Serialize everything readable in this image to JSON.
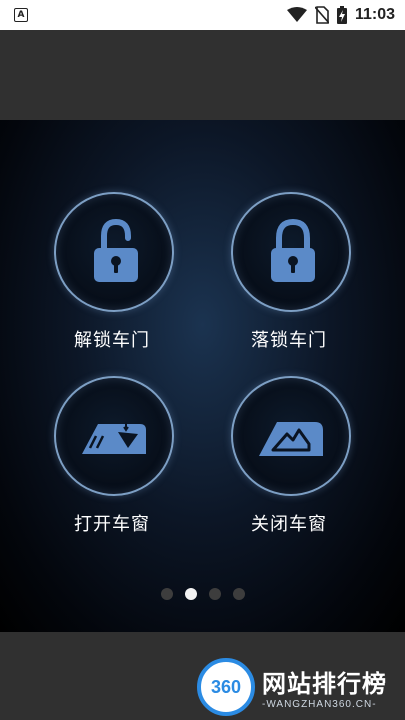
{
  "status_bar": {
    "time": "11:03",
    "app_indicator": "A",
    "icons": [
      "wifi-icon",
      "no-sim-icon",
      "battery-charging-icon"
    ]
  },
  "controls": [
    {
      "label": "解锁车门",
      "icon": "unlock-icon"
    },
    {
      "label": "落锁车门",
      "icon": "lock-icon"
    },
    {
      "label": "打开车窗",
      "icon": "window-open-icon"
    },
    {
      "label": "关闭车窗",
      "icon": "window-close-icon"
    }
  ],
  "pager": {
    "count": 4,
    "active_index": 1
  },
  "watermark": {
    "logo_text": "360",
    "title": "网站排行榜",
    "subtitle": "-WANGZHAN360.CN-"
  },
  "colors": {
    "accent": "#5b8ac8",
    "ring": "#7d9fc4",
    "watermark_blue": "#2b8be3"
  }
}
